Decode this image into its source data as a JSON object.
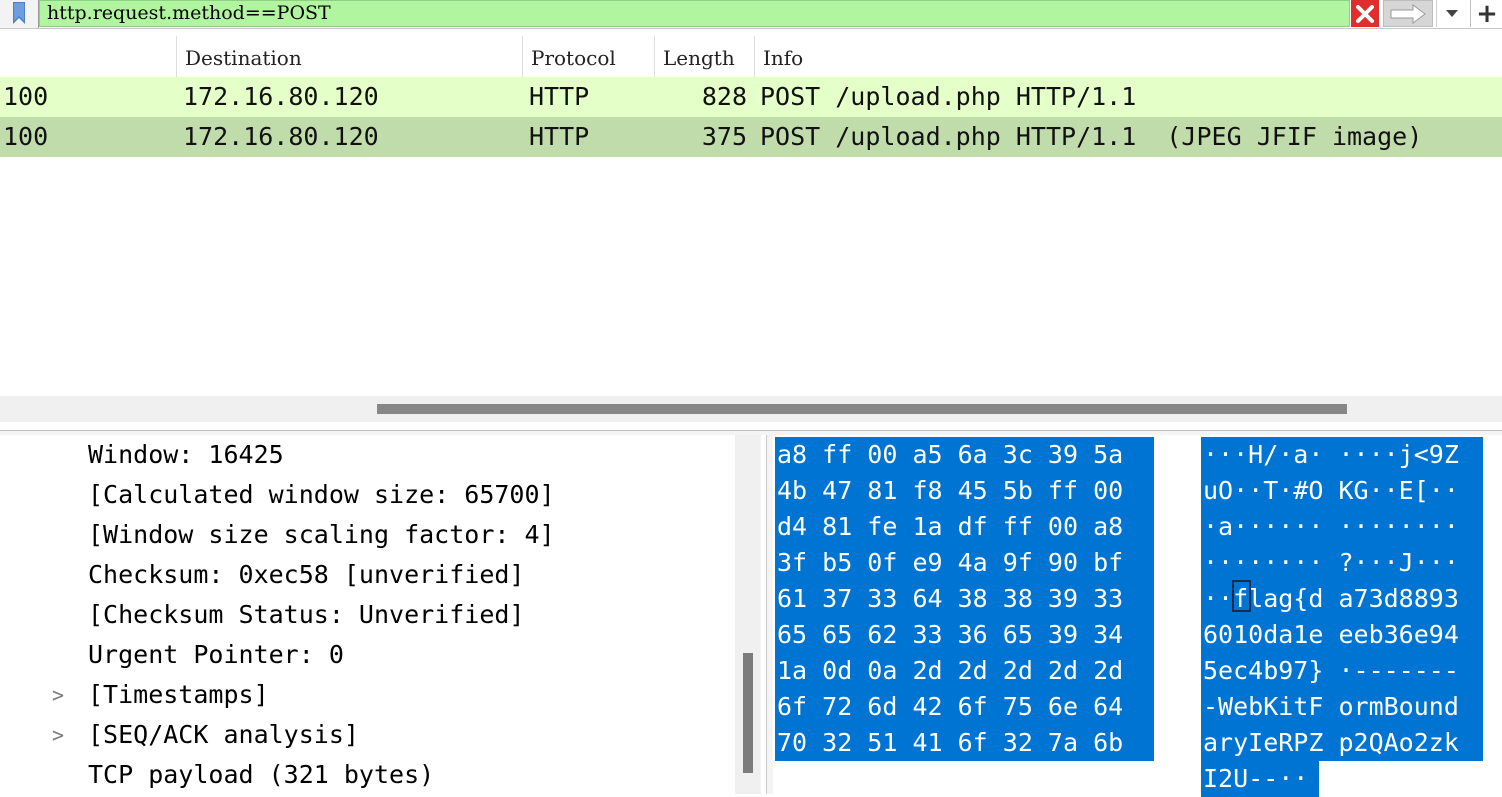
{
  "filter": {
    "value": "http.request.method==POST",
    "bookmark_icon": "bookmark-icon",
    "clear_icon": "clear-x-icon",
    "apply_icon": "arrow-right-icon",
    "dropdown_icon": "chevron-down-icon",
    "add_icon": "plus-icon",
    "add_label": "+"
  },
  "packet_list": {
    "columns": [
      "",
      "Destination",
      "Protocol",
      "Length",
      "Info"
    ],
    "rows": [
      {
        "source": "100",
        "destination": "172.16.80.120",
        "protocol": "HTTP",
        "length": "828",
        "info": "POST /upload.php HTTP/1.1"
      },
      {
        "source": "100",
        "destination": "172.16.80.120",
        "protocol": "HTTP",
        "length": "375",
        "info": "POST /upload.php HTTP/1.1  (JPEG JFIF image)"
      }
    ]
  },
  "details": [
    {
      "text": "Window: 16425",
      "expandable": false
    },
    {
      "text": "[Calculated window size: 65700]",
      "expandable": false
    },
    {
      "text": "[Window size scaling factor: 4]",
      "expandable": false
    },
    {
      "text": "Checksum: 0xec58 [unverified]",
      "expandable": false
    },
    {
      "text": "[Checksum Status: Unverified]",
      "expandable": false
    },
    {
      "text": "Urgent Pointer: 0",
      "expandable": false
    },
    {
      "text": "[Timestamps]",
      "expandable": true
    },
    {
      "text": "[SEQ/ACK analysis]",
      "expandable": true
    },
    {
      "text": "TCP payload (321 bytes)",
      "expandable": false
    }
  ],
  "expander_glyph": ">",
  "bytes": {
    "hex": [
      "a8 ff 00 a5 6a 3c 39 5a",
      "4b 47 81 f8 45 5b ff 00",
      "d4 81 fe 1a df ff 00 a8",
      "3f b5 0f e9 4a 9f 90 bf",
      "61 37 33 64 38 38 39 33",
      "65 65 62 33 36 65 39 34",
      "1a 0d 0a 2d 2d 2d 2d 2d",
      "6f 72 6d 42 6f 75 6e 64",
      "70 32 51 41 6f 32 7a 6b"
    ],
    "ascii": [
      "···H/·a· ····j<9Z",
      "uO··T·#O KG··E[··",
      "·a······ ········",
      "········ ?···J···",
      "··flag{d a73d8893",
      "6010da1e eeb36e94",
      "5ec4b97} ·-------",
      "-WebKitF ormBound",
      "aryIeRPZ p2QAo2zk",
      "I2U--··"
    ]
  },
  "colors": {
    "filter_valid": "#b1f5a1",
    "row_http": "#e4ffc7",
    "row_selected": "#c1dcab",
    "bytes_highlight": "#0074d2"
  }
}
